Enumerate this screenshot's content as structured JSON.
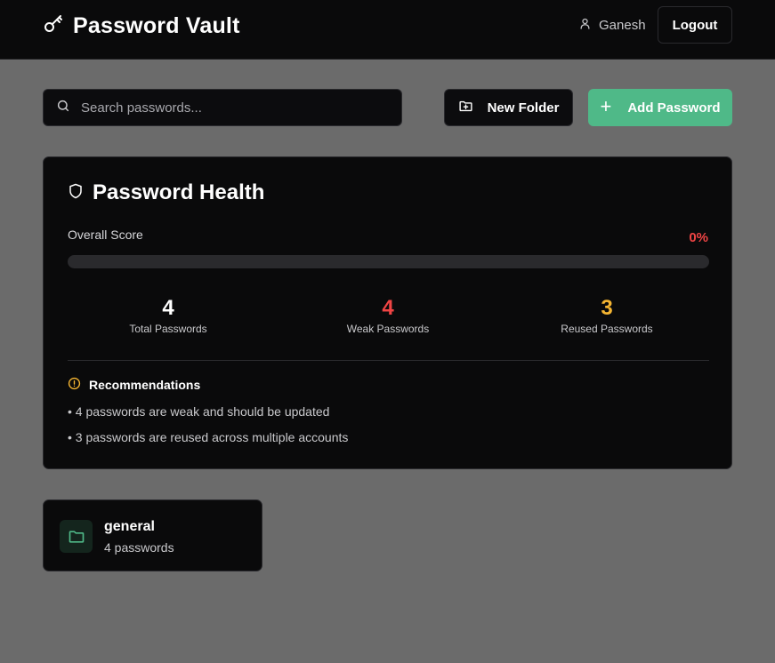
{
  "header": {
    "title": "Password Vault",
    "logo_icon": "key-icon",
    "user_icon": "user-icon",
    "username": "Ganesh",
    "logout_label": "Logout"
  },
  "toolbar": {
    "search_icon": "search-icon",
    "search_placeholder": "Search passwords...",
    "search_value": "",
    "new_folder_icon": "folder-plus-icon",
    "new_folder_label": "New Folder",
    "add_password_icon": "plus-icon",
    "add_password_label": "Add Password"
  },
  "health": {
    "icon": "shield-icon",
    "title": "Password Health",
    "score_label": "Overall Score",
    "score_value": "0%",
    "score_fraction": 0,
    "stats": [
      {
        "value": "4",
        "label": "Total Passwords",
        "color": "#ffffff"
      },
      {
        "value": "4",
        "label": "Weak Passwords",
        "color": "#ef4444"
      },
      {
        "value": "3",
        "label": "Reused Passwords",
        "color": "#f5b532"
      }
    ],
    "recommendations_icon": "alert-circle-icon",
    "recommendations_title": "Recommendations",
    "recommendations": [
      "• 4 passwords are weak and should be updated",
      "• 3 passwords are reused across multiple accounts"
    ]
  },
  "folders": [
    {
      "icon": "folder-icon",
      "name": "general",
      "count": "4 passwords"
    }
  ],
  "colors": {
    "accent": "#4fb988",
    "danger": "#ef4444",
    "warning": "#f5b532",
    "background": "#6b6b6b",
    "surface": "#0a0a0b"
  }
}
